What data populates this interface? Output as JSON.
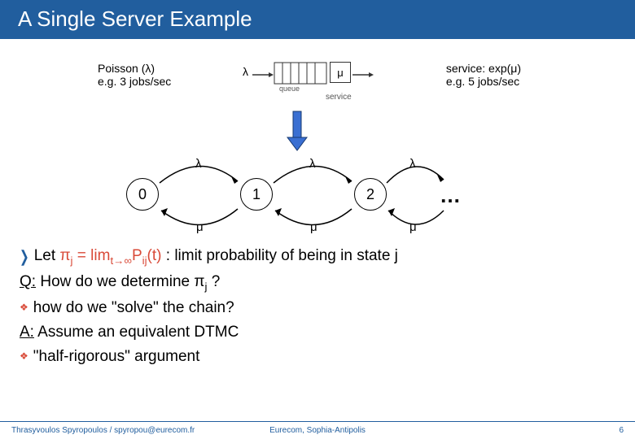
{
  "title": "A Single Server Example",
  "queue_diagram": {
    "arrival_label_1": "Poisson (λ)",
    "arrival_label_2": "e.g. 3 jobs/sec",
    "service_label_1": "service: exp(μ)",
    "service_label_2": "e.g. 5 jobs/sec",
    "lambda_symbol": "λ",
    "mu_symbol": "μ",
    "queue_tag": "queue",
    "service_tag": "service"
  },
  "markov_chain": {
    "states": [
      "0",
      "1",
      "2"
    ],
    "ellipsis": "…",
    "forward_label": "λ",
    "backward_label": "μ"
  },
  "body": {
    "let_prefix": "Let ",
    "let_math": "πj = limt→∞Pij(t)",
    "let_suffix": " : limit probability of being in state j",
    "q_prefix": "Q:",
    "q_text_a": " How do we determine π",
    "q_sub": "j",
    "q_text_b": " ?",
    "q_bullet": "how do we \"solve\" the chain?",
    "a_prefix": "A:",
    "a_text": " Assume an equivalent DTMC",
    "a_bullet": "\"half-rigorous\" argument"
  },
  "footer": {
    "left": "Thrasyvoulos Spyropoulos / spyropou@eurecom.fr",
    "center": "Eurecom, Sophia-Antipolis",
    "right": "6"
  }
}
